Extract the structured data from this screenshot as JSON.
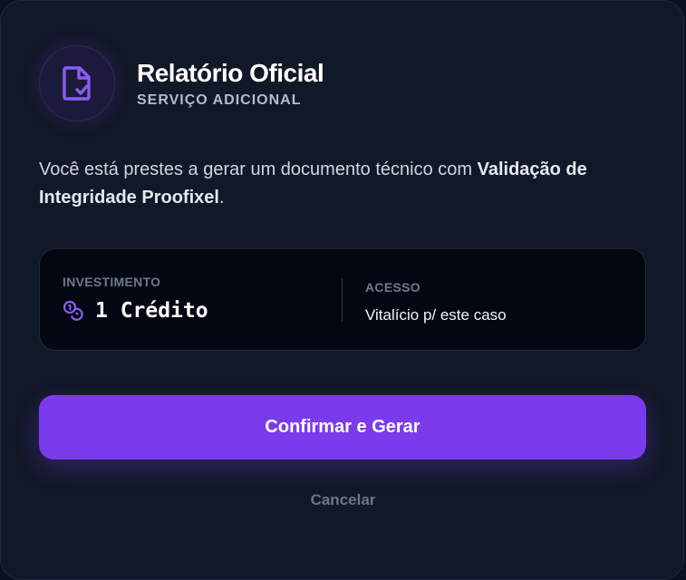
{
  "header": {
    "title": "Relatório Oficial",
    "subtitle": "SERVIÇO ADICIONAL",
    "icon": "file-check-icon"
  },
  "description": {
    "before": "Você está prestes a gerar um documento técnico com ",
    "highlight": "Validação de Integridade Proofixel",
    "after": "."
  },
  "investment": {
    "label": "INVESTIMENTO",
    "icon": "coins-icon",
    "value": "1 Crédito"
  },
  "access": {
    "label": "ACESSO",
    "value": "Vitalício p/ este caso"
  },
  "actions": {
    "confirm_label": "Confirmar e Gerar",
    "cancel_label": "Cancelar"
  },
  "colors": {
    "accent": "#7c3aed",
    "background": "#111827",
    "panel": "#030712"
  }
}
